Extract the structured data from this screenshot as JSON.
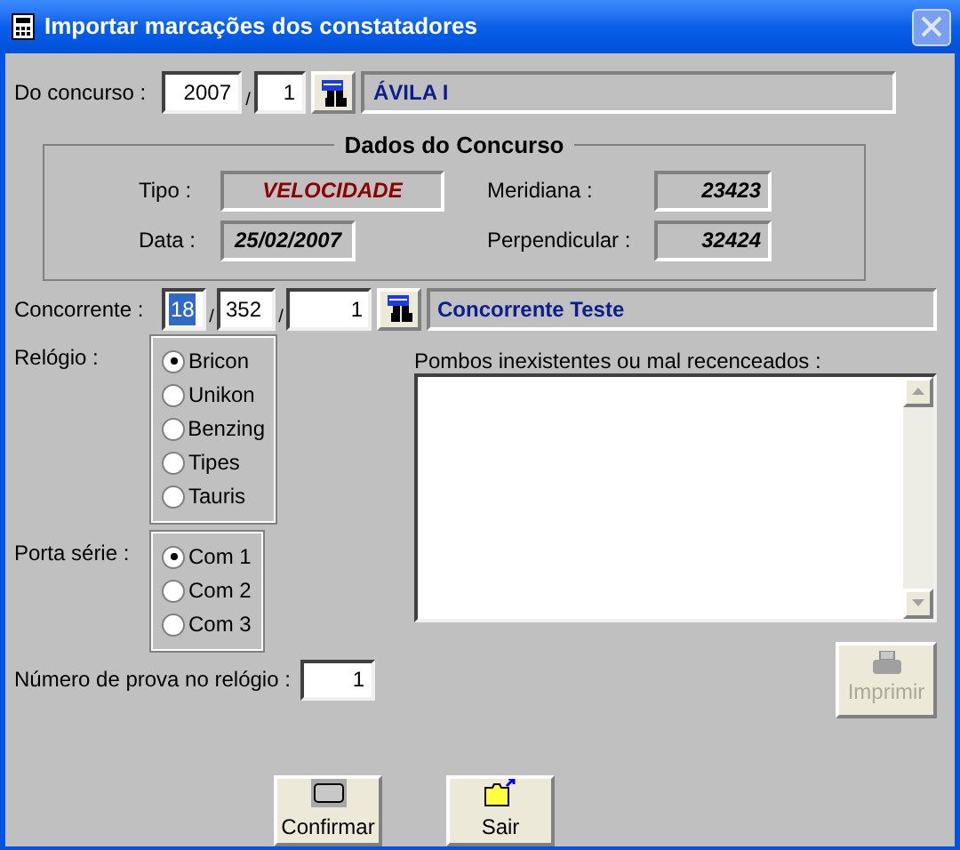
{
  "window": {
    "title": "Importar marcações dos constatadores"
  },
  "concurso": {
    "label": "Do concurso :",
    "year": "2007",
    "separator": "/",
    "number": "1",
    "name": "ÁVILA I"
  },
  "dados": {
    "title": "Dados do Concurso",
    "tipo": {
      "label": "Tipo :",
      "value": "VELOCIDADE"
    },
    "data": {
      "label": "Data :",
      "value": "25/02/2007"
    },
    "meridiana": {
      "label": "Meridiana :",
      "value": "23423"
    },
    "perpendicular": {
      "label": "Perpendicular :",
      "value": "32424"
    }
  },
  "concorrente": {
    "label": "Concorrente :",
    "separators": [
      "/",
      "/"
    ],
    "name": "Concorrente Teste",
    "parts": [
      {
        "value": "18",
        "selected": true
      },
      {
        "value": "352",
        "selected": false
      },
      {
        "value": "1",
        "selected": false
      }
    ]
  },
  "relogio": {
    "label": "Relógio :",
    "options": [
      {
        "label": "Bricon",
        "selected": true
      },
      {
        "label": "Unikon",
        "selected": false
      },
      {
        "label": "Benzing",
        "selected": false
      },
      {
        "label": "Tipes",
        "selected": false
      },
      {
        "label": "Tauris",
        "selected": false
      }
    ]
  },
  "porta_serie": {
    "label": "Porta série :",
    "options": [
      {
        "label": "Com 1",
        "selected": true
      },
      {
        "label": "Com 2",
        "selected": false
      },
      {
        "label": "Com 3",
        "selected": false
      }
    ]
  },
  "numero_prova": {
    "label": "Número de prova no relógio :",
    "value": "1"
  },
  "pombos": {
    "label": "Pombos inexistentes ou mal recenceados :"
  },
  "print_button": {
    "label": "Imprimir",
    "disabled": true
  },
  "actions": [
    {
      "label": "Confirmar",
      "kind": "confirm"
    },
    {
      "label": "Sair",
      "kind": "exit"
    }
  ]
}
